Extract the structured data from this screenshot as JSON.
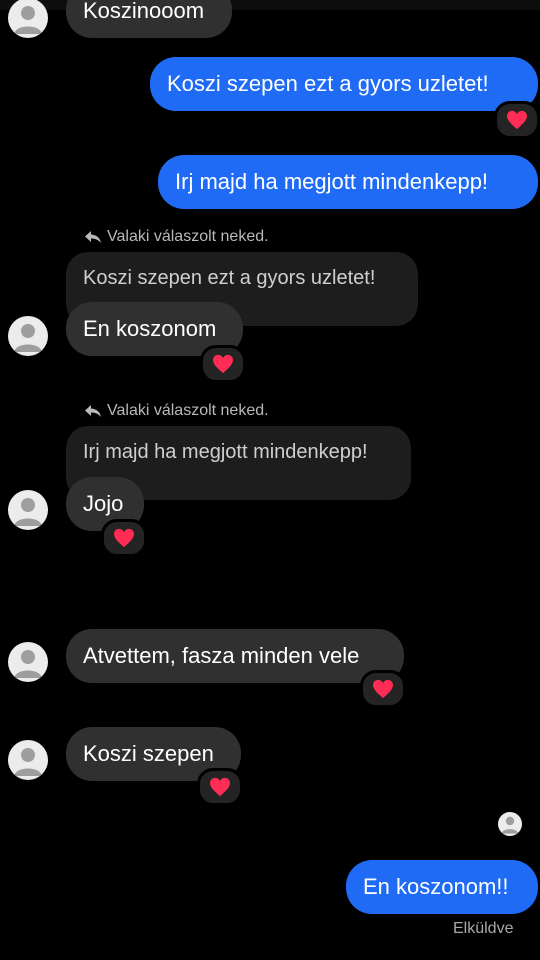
{
  "messages": {
    "m1": "Koszinooom",
    "m2": "Koszi szepen ezt a gyors uzletet!",
    "m3": "Irj majd ha megjott mindenkepp!",
    "m4_reply_label": "Valaki válaszolt neked.",
    "m4_quote": "Koszi szepen ezt a gyors uzletet!",
    "m4": "En koszonom",
    "m5_reply_label": "Valaki válaszolt neked.",
    "m5_quote": "Irj majd ha megjott mindenkepp!",
    "m5": "Jojo",
    "m6": "Atvettem, fasza minden vele",
    "m7": "Koszi szepen",
    "m8": "En koszonom!!"
  },
  "status": {
    "sent_label": "Elküldve"
  },
  "icons": {
    "reaction": "heart-icon",
    "reply": "reply-arrow-icon",
    "avatar": "default-avatar-icon"
  },
  "colors": {
    "background": "#000000",
    "outgoing_bubble": "#1f6bf5",
    "incoming_bubble": "#303030",
    "quoted_bubble": "#1d1d1d",
    "heart": "#ff2d55"
  }
}
